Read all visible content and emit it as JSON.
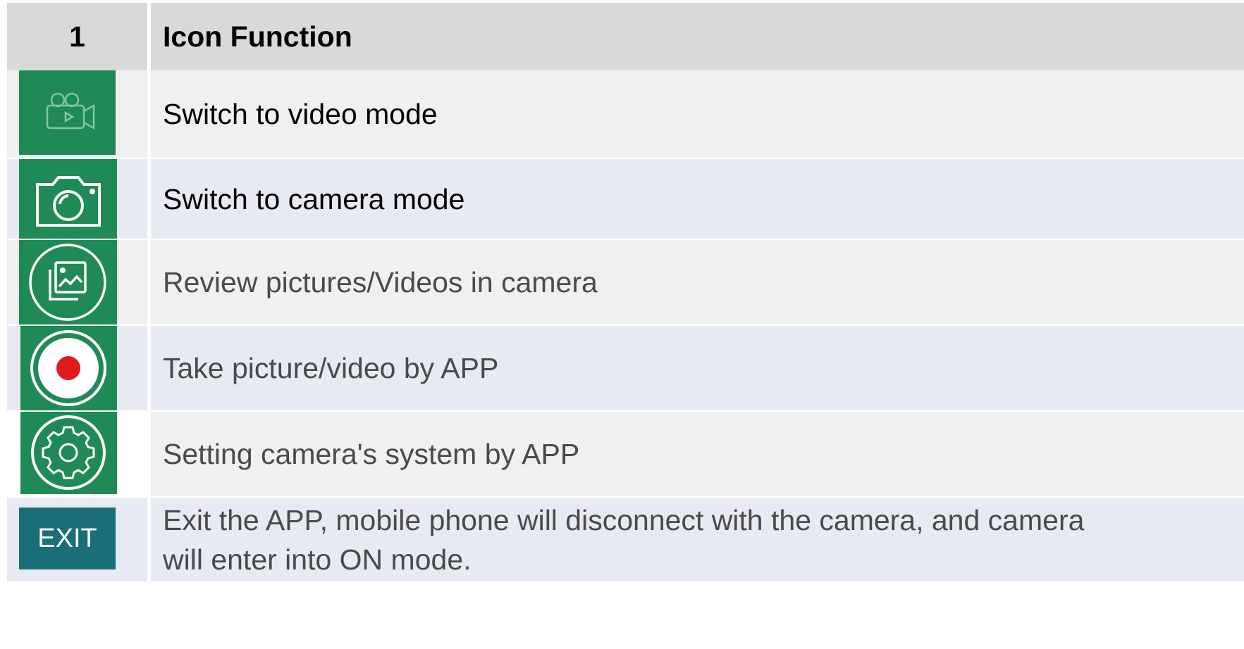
{
  "table": {
    "header": {
      "number": "1",
      "title": "Icon Function"
    },
    "rows": [
      {
        "icon": "video-camera-icon",
        "text": "Switch to video mode"
      },
      {
        "icon": "photo-camera-icon",
        "text": "Switch to camera mode"
      },
      {
        "icon": "gallery-icon",
        "text": "Review pictures/Videos in camera"
      },
      {
        "icon": "record-icon",
        "text": "Take picture/video by APP"
      },
      {
        "icon": "gear-icon",
        "text": "Setting camera's system by APP"
      },
      {
        "icon": "exit-icon",
        "icon_label": "EXIT",
        "text_line1": "Exit the APP, mobile phone will disconnect with the camera, and camera",
        "text_line2": "will enter into ON mode."
      }
    ]
  },
  "colors": {
    "icon_green": "#1f8a56",
    "exit_teal": "#1a6e78",
    "record_red": "#e01b1b",
    "header_bg": "#d9d9d9"
  }
}
